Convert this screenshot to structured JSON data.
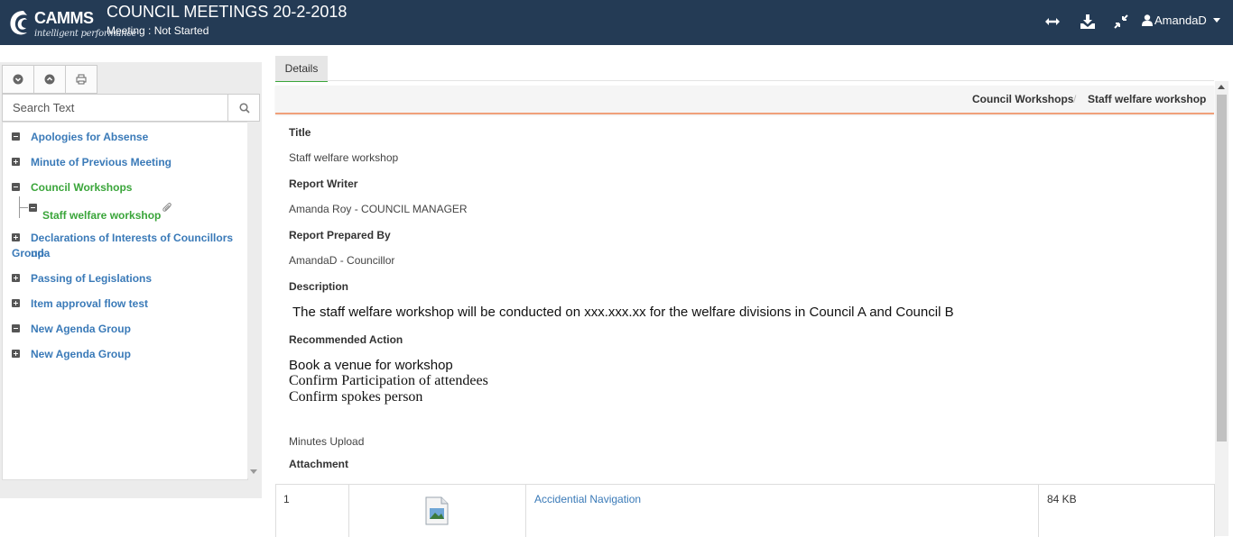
{
  "header": {
    "logo": {
      "brand": "CAMMS",
      "tagline": "intelligent performance"
    },
    "title": "COUNCIL MEETINGS 20-2-2018",
    "subtitle": "Meeting : Not Started",
    "icons": [
      "expand-horizontal-icon",
      "download-icon",
      "compress-icon"
    ],
    "user": "AmandaD"
  },
  "sidebar": {
    "toolbar": [
      "expand-all-icon",
      "collapse-all-icon",
      "print-icon"
    ],
    "search_placeholder": "Search Text",
    "tree": [
      {
        "label": "Apologies for Absense",
        "state": "collapse"
      },
      {
        "label": "Minute of Previous Meeting",
        "state": "expand"
      },
      {
        "label": "Council Workshops",
        "state": "collapse",
        "selected_parent": true,
        "children": [
          {
            "label": "Staff welfare workshop",
            "selected": true,
            "attachment_icon": "paperclip-icon"
          }
        ]
      },
      {
        "label_line1": "Declarations of Interests of Councillors nda",
        "label_line2": "Group",
        "state": "expand"
      },
      {
        "label": "Passing of Legislations",
        "state": "expand"
      },
      {
        "label": "Item approval flow test",
        "state": "expand"
      },
      {
        "label": "New Agenda Group",
        "state": "collapse"
      },
      {
        "label": "New Agenda Group",
        "state": "expand"
      }
    ]
  },
  "main": {
    "tab": "Details",
    "breadcrumb": [
      "Council Workshops",
      "Staff welfare workshop"
    ],
    "fields": {
      "title_label": "Title",
      "title_value": "Staff welfare workshop",
      "writer_label": "Report Writer",
      "writer_value": "Amanda Roy - COUNCIL MANAGER",
      "prepared_label": "Report Prepared By",
      "prepared_value": "AmandaD - Councillor",
      "description_label": "Description",
      "description_value": "The staff welfare workshop will be conducted on xxx.xxx.xx for the welfare divisions in Council A and Council B",
      "recommended_label": "Recommended Action",
      "recommended_lines": [
        "Book a venue for workshop",
        "Confirm Participation of attendees",
        "Confirm spokes person"
      ],
      "minutes_label": "Minutes Upload",
      "attachment_label": "Attachment"
    },
    "attachments": [
      {
        "index": "1",
        "icon": "image-file-icon",
        "name": "Accidential Navigation",
        "size": "84 KB"
      }
    ]
  },
  "colors": {
    "header_bg": "#243b55",
    "link_blue": "#3a7ab8",
    "selected_green": "#3aa53a",
    "accent_orange": "#f0a07a"
  }
}
